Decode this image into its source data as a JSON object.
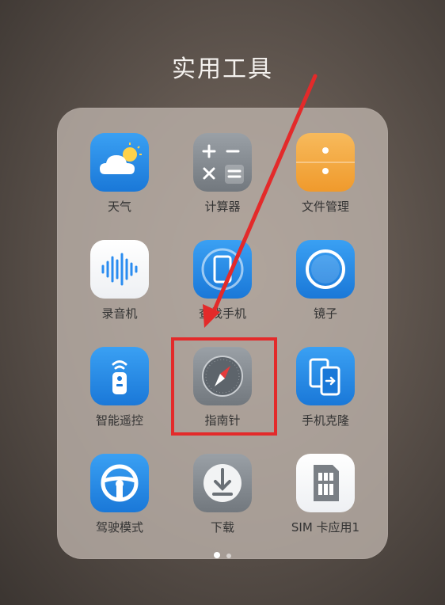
{
  "folder": {
    "title": "实用工具"
  },
  "apps": [
    {
      "label": "天气",
      "icon": "weather-icon"
    },
    {
      "label": "计算器",
      "icon": "calculator-icon"
    },
    {
      "label": "文件管理",
      "icon": "file-manager-icon"
    },
    {
      "label": "录音机",
      "icon": "recorder-icon"
    },
    {
      "label": "查找手机",
      "icon": "find-phone-icon"
    },
    {
      "label": "镜子",
      "icon": "mirror-icon"
    },
    {
      "label": "智能遥控",
      "icon": "remote-control-icon"
    },
    {
      "label": "指南针",
      "icon": "compass-icon"
    },
    {
      "label": "手机克隆",
      "icon": "phone-clone-icon"
    },
    {
      "label": "驾驶模式",
      "icon": "driving-mode-icon"
    },
    {
      "label": "下载",
      "icon": "download-icon"
    },
    {
      "label": "SIM 卡应用1",
      "icon": "sim-card-icon"
    }
  ],
  "page_indicator": {
    "total": 2,
    "active": 1
  },
  "annotation": {
    "color": "#e32a2a",
    "target": "指南针"
  }
}
